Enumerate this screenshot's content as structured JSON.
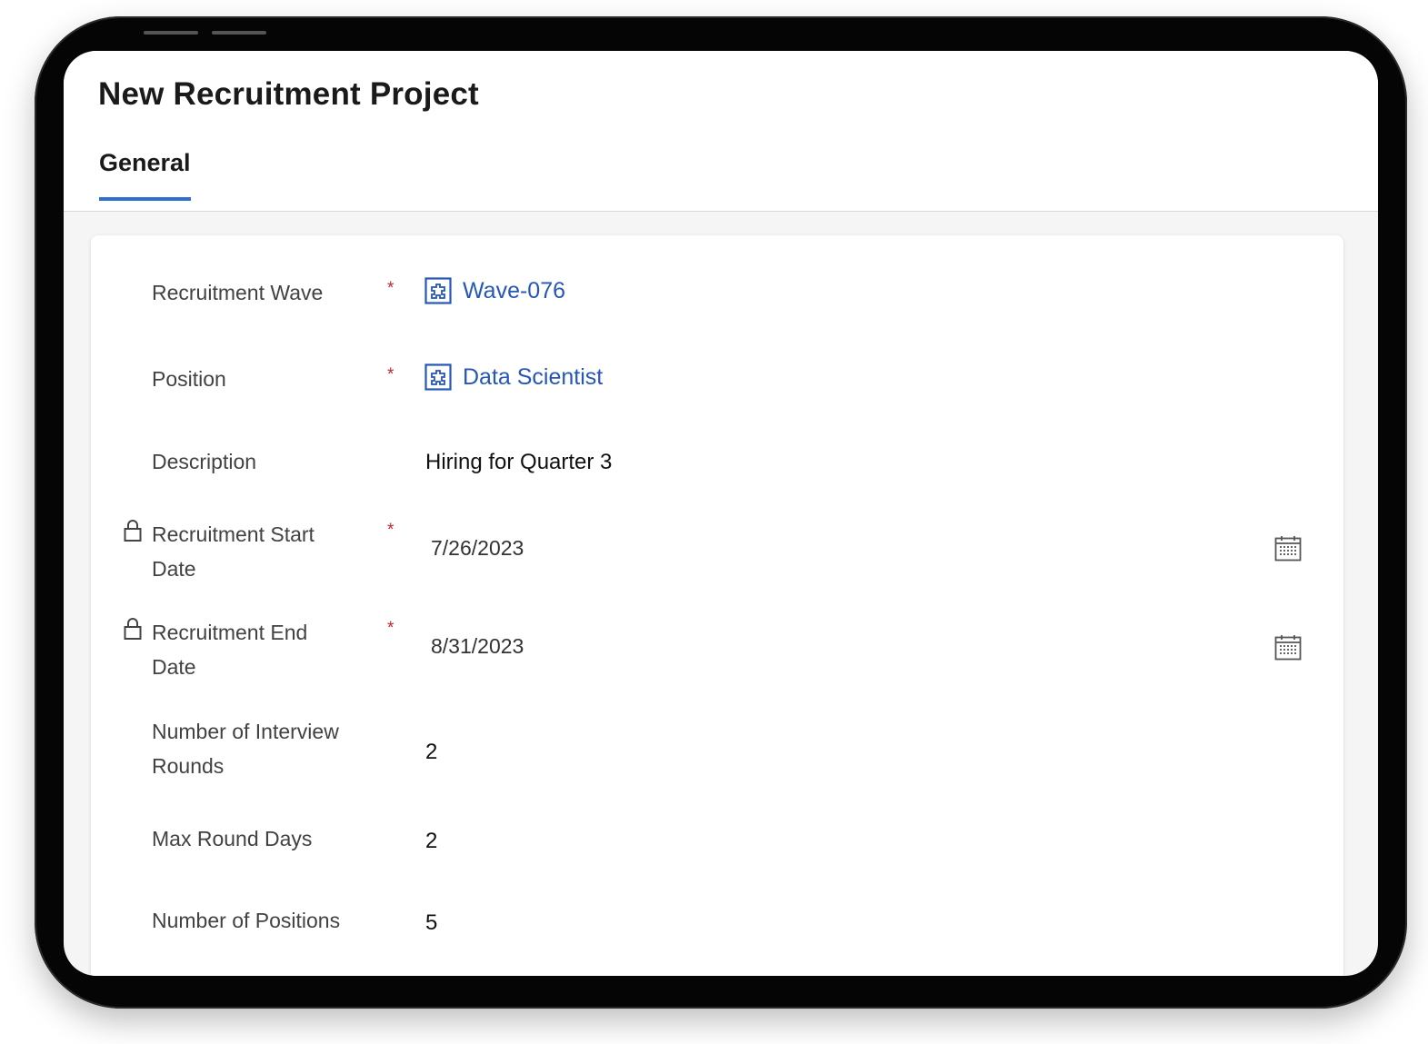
{
  "page": {
    "title": "New Recruitment Project",
    "tabs": [
      {
        "label": "General",
        "active": true
      }
    ]
  },
  "form": {
    "recruitment_wave": {
      "label": "Recruitment Wave",
      "required_mark": "*",
      "value": "Wave-076",
      "icon": "entity-lookup-icon"
    },
    "position": {
      "label": "Position",
      "required_mark": "*",
      "value": "Data Scientist",
      "icon": "entity-lookup-icon"
    },
    "description": {
      "label": "Description",
      "value": "Hiring for Quarter 3"
    },
    "start_date": {
      "label_line1": "Recruitment Start",
      "label_line2": "Date",
      "required_mark": "*",
      "value": "7/26/2023",
      "locked": true,
      "icon": "calendar-icon"
    },
    "end_date": {
      "label_line1": "Recruitment End",
      "label_line2": "Date",
      "required_mark": "*",
      "value": "8/31/2023",
      "locked": true,
      "icon": "calendar-icon"
    },
    "interview_rounds": {
      "label_line1": "Number of Interview",
      "label_line2": "Rounds",
      "value": "2"
    },
    "max_round_days": {
      "label": "Max Round Days",
      "value": "2"
    },
    "number_of_positions": {
      "label": "Number of Positions",
      "value": "5"
    }
  },
  "colors": {
    "accent": "#2f6fd1",
    "link": "#2556b8",
    "required": "#c4262e",
    "device_frame": "#050505"
  }
}
